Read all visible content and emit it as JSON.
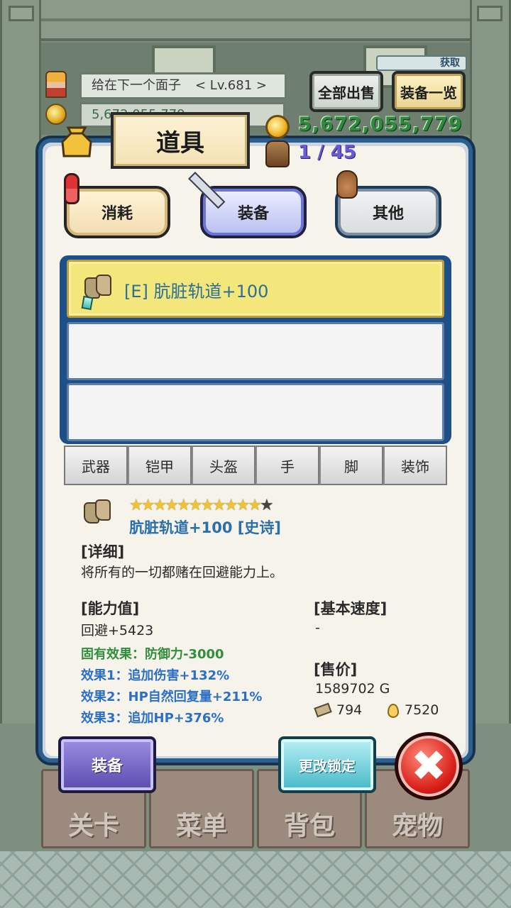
{
  "hud": {
    "player_name": "给在下一个面子",
    "player_level": "< Lv.681 >",
    "player_gold": "5,672,055,779",
    "defeat_badge": "获取",
    "sell_all_label": "全部出售",
    "equip_list_label": "装备一览"
  },
  "panel": {
    "title": "道具",
    "gold": "5,672,055,779",
    "capacity": "1 / 45"
  },
  "categories": [
    {
      "label": "消耗",
      "icon": "potion-icon"
    },
    {
      "label": "装备",
      "icon": "sword-icon",
      "selected": true
    },
    {
      "label": "其他",
      "icon": "pouch-icon"
    }
  ],
  "item_list": [
    {
      "label": "[E] 肮脏轨道+100",
      "icon": "boot-icon",
      "selected": true
    },
    {
      "label": ""
    },
    {
      "label": ""
    }
  ],
  "slot_tabs": [
    "武器",
    "铠甲",
    "头盔",
    "手",
    "脚",
    "装饰"
  ],
  "detail": {
    "stars_filled": "★★★★★★★★★★★",
    "stars_empty": "★",
    "name": "肮脏轨道+100 [史诗]",
    "detail_header": "[详细]",
    "description": "将所有的一切都赌在回避能力上。",
    "stats_header": "[能力值]",
    "stat_main": "回避+5423",
    "innate_effect": "固有效果：防御力-3000",
    "effect1": "效果1：追加伤害+132%",
    "effect2": "效果2：HP自然回复量+211%",
    "effect3": "效果3：追加HP+376%",
    "speed_header": "[基本速度]",
    "speed_value": "-",
    "price_header": "[售价]",
    "price_gold": "1589702 G",
    "price_material": "794",
    "price_drop": "7520"
  },
  "buttons": {
    "equip": "装备",
    "change_lock": "更改锁定",
    "close": "✖"
  },
  "nav": [
    "关卡",
    "菜单",
    "背包",
    "宠物"
  ],
  "colors": {
    "panel_border": "#2d5f8e",
    "gold_text": "#2e8a3e",
    "capacity_text": "#6b5ad6",
    "item_name": "#2b6fa8",
    "effect_green": "#2f8f3a",
    "effect_blue": "#2c6fc8",
    "selected_row": "#f3e67a",
    "close_button": "#d8201a"
  }
}
